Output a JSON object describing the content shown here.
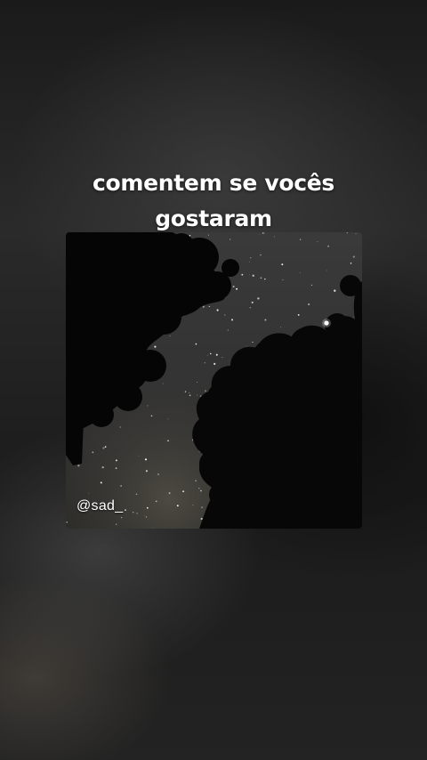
{
  "post": {
    "caption_line1": "comentem se vocês",
    "caption_line2": "gostaram",
    "watermark": "@sad_"
  },
  "image": {
    "subject": "night-sky-trees-photo"
  }
}
